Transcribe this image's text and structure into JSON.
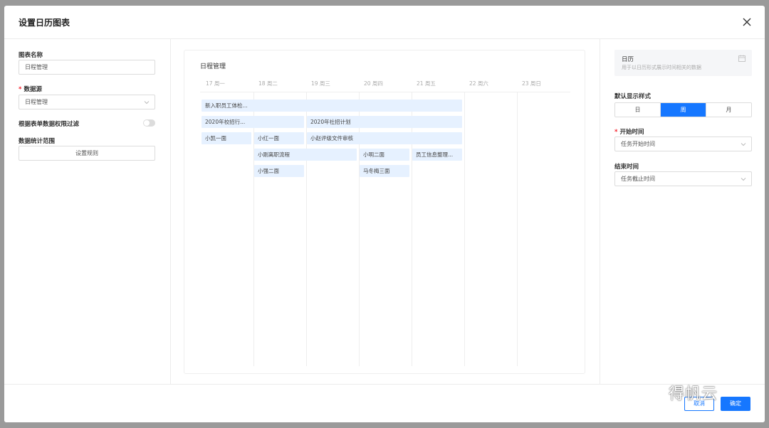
{
  "modal": {
    "title": "设置日历图表"
  },
  "left": {
    "chart_name_label": "图表名称",
    "chart_name_value": "日程管理",
    "datasource_label": "数据源",
    "datasource_value": "日程管理",
    "permission_filter_label": "根据表单数据权限过滤",
    "permission_filter_on": false,
    "stats_range_label": "数据统计范围",
    "set_rule_label": "设置规则"
  },
  "preview": {
    "title": "日程管理",
    "days": [
      "17 周一",
      "18 周二",
      "19 周三",
      "20 周四",
      "21 周五",
      "22 周六",
      "23 周日"
    ],
    "events": [
      {
        "label": "新入职员工体检...",
        "start": 0,
        "span": 5,
        "row": 0
      },
      {
        "label": "2020年校招行...",
        "start": 0,
        "span": 2,
        "row": 1
      },
      {
        "label": "2020年社招计划",
        "start": 2,
        "span": 3,
        "row": 1
      },
      {
        "label": "小凯一面",
        "start": 0,
        "span": 1,
        "row": 2
      },
      {
        "label": "小红一面",
        "start": 1,
        "span": 1,
        "row": 2
      },
      {
        "label": "小赵评级文件审核",
        "start": 2,
        "span": 3,
        "row": 2
      },
      {
        "label": "小刚离职流程",
        "start": 1,
        "span": 2,
        "row": 3
      },
      {
        "label": "小明二面",
        "start": 3,
        "span": 1,
        "row": 3
      },
      {
        "label": "员工信息整理...",
        "start": 4,
        "span": 1,
        "row": 3
      },
      {
        "label": "小强二面",
        "start": 1,
        "span": 1,
        "row": 4
      },
      {
        "label": "马冬梅三面",
        "start": 3,
        "span": 1,
        "row": 4
      }
    ]
  },
  "right": {
    "type_title": "日历",
    "type_desc": "用于以日历形式展示时间相关的数据",
    "type_icon": "calendar-icon",
    "default_view_label": "默认显示样式",
    "views": [
      "日",
      "周",
      "月"
    ],
    "active_view": "周",
    "start_time_label": "开始时间",
    "start_time_value": "任务开始时间",
    "end_time_label": "结束时间",
    "end_time_value": "任务截止时间"
  },
  "footer": {
    "cancel_label": "取消",
    "ok_label": "确定"
  },
  "watermark": {
    "text": "得帆云",
    "icon": "wechat-icon"
  },
  "colors": {
    "primary": "#1677ff",
    "event_bg": "#e6f1ff",
    "required": "#f5222d"
  }
}
